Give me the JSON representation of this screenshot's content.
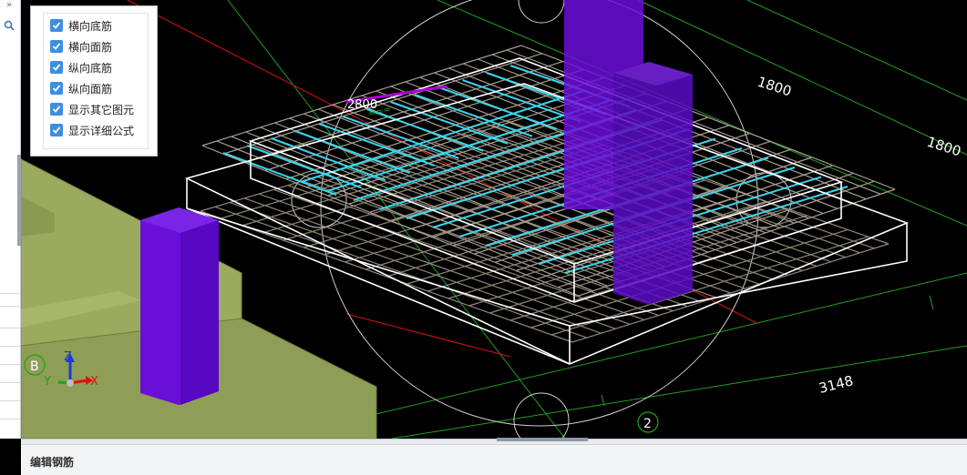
{
  "layers_panel": {
    "items": [
      {
        "label": "横向底筋",
        "checked": true
      },
      {
        "label": "横向面筋",
        "checked": true
      },
      {
        "label": "纵向底筋",
        "checked": true
      },
      {
        "label": "纵向面筋",
        "checked": true
      },
      {
        "label": "显示其它图元",
        "checked": true
      },
      {
        "label": "显示详细公式",
        "checked": true
      }
    ]
  },
  "viewport": {
    "dimensions": [
      "1800",
      "1800",
      "3148",
      "2800"
    ],
    "axis_markers": [
      "B",
      "2"
    ],
    "triad": {
      "x": "X",
      "y": "Y",
      "z": "Z"
    },
    "colors": {
      "background": "#000000",
      "column": "#6a0fd8",
      "slab_edge": "#ffffff",
      "rebar_grid": "#8f8577",
      "rebar_top": "#38d8ee",
      "terrain": "#9aab5f",
      "axis_red": "#e01010",
      "axis_green": "#1fa11f"
    }
  },
  "bottom_panel": {
    "title": "编辑钢筋"
  },
  "icons": {
    "search": "search-icon",
    "collapse": "double-chevron-right-icon",
    "check": "checkmark-icon"
  }
}
